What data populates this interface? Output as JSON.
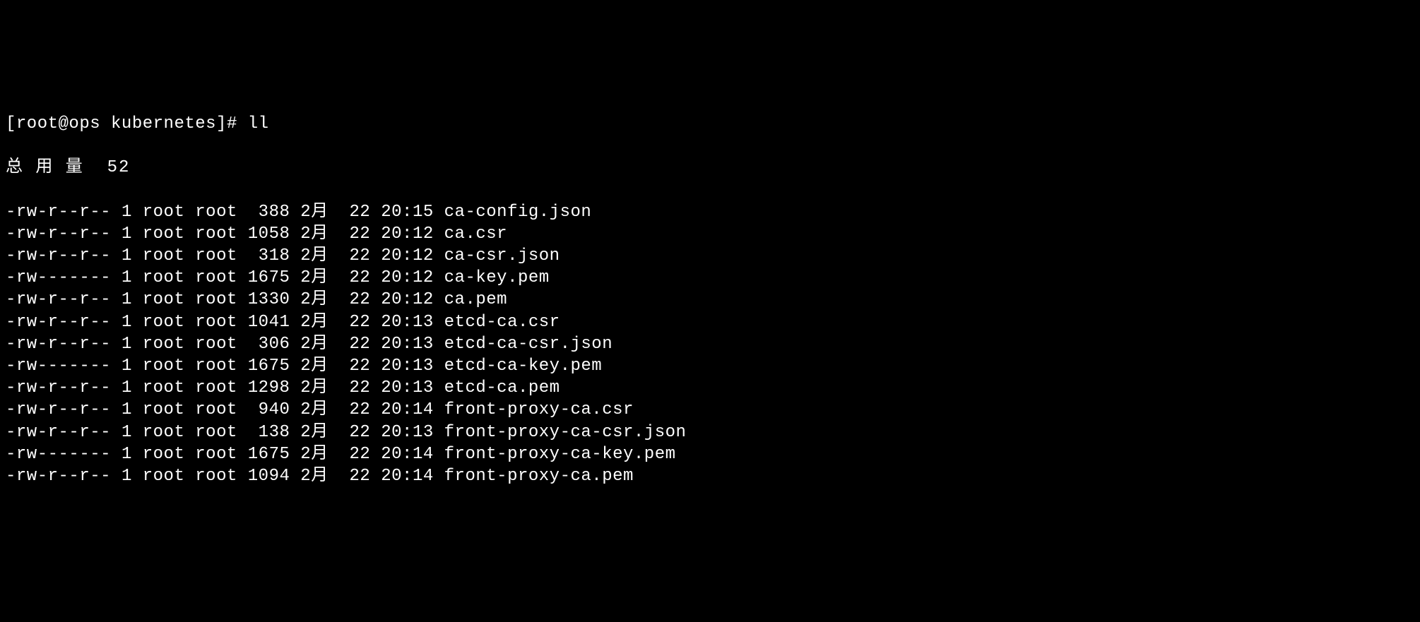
{
  "prompt": {
    "text": "[root@ops kubernetes]# ll"
  },
  "total": {
    "label": "总 用 量",
    "value": "52"
  },
  "files": [
    {
      "perms": "-rw-r--r--",
      "links": "1",
      "owner": "root",
      "group": "root",
      "size": " 388",
      "month": "2月",
      "day": "22",
      "time": "20:15",
      "name": "ca-config.json"
    },
    {
      "perms": "-rw-r--r--",
      "links": "1",
      "owner": "root",
      "group": "root",
      "size": "1058",
      "month": "2月",
      "day": "22",
      "time": "20:12",
      "name": "ca.csr"
    },
    {
      "perms": "-rw-r--r--",
      "links": "1",
      "owner": "root",
      "group": "root",
      "size": " 318",
      "month": "2月",
      "day": "22",
      "time": "20:12",
      "name": "ca-csr.json"
    },
    {
      "perms": "-rw-------",
      "links": "1",
      "owner": "root",
      "group": "root",
      "size": "1675",
      "month": "2月",
      "day": "22",
      "time": "20:12",
      "name": "ca-key.pem"
    },
    {
      "perms": "-rw-r--r--",
      "links": "1",
      "owner": "root",
      "group": "root",
      "size": "1330",
      "month": "2月",
      "day": "22",
      "time": "20:12",
      "name": "ca.pem"
    },
    {
      "perms": "-rw-r--r--",
      "links": "1",
      "owner": "root",
      "group": "root",
      "size": "1041",
      "month": "2月",
      "day": "22",
      "time": "20:13",
      "name": "etcd-ca.csr"
    },
    {
      "perms": "-rw-r--r--",
      "links": "1",
      "owner": "root",
      "group": "root",
      "size": " 306",
      "month": "2月",
      "day": "22",
      "time": "20:13",
      "name": "etcd-ca-csr.json"
    },
    {
      "perms": "-rw-------",
      "links": "1",
      "owner": "root",
      "group": "root",
      "size": "1675",
      "month": "2月",
      "day": "22",
      "time": "20:13",
      "name": "etcd-ca-key.pem"
    },
    {
      "perms": "-rw-r--r--",
      "links": "1",
      "owner": "root",
      "group": "root",
      "size": "1298",
      "month": "2月",
      "day": "22",
      "time": "20:13",
      "name": "etcd-ca.pem"
    },
    {
      "perms": "-rw-r--r--",
      "links": "1",
      "owner": "root",
      "group": "root",
      "size": " 940",
      "month": "2月",
      "day": "22",
      "time": "20:14",
      "name": "front-proxy-ca.csr"
    },
    {
      "perms": "-rw-r--r--",
      "links": "1",
      "owner": "root",
      "group": "root",
      "size": " 138",
      "month": "2月",
      "day": "22",
      "time": "20:13",
      "name": "front-proxy-ca-csr.json"
    },
    {
      "perms": "-rw-------",
      "links": "1",
      "owner": "root",
      "group": "root",
      "size": "1675",
      "month": "2月",
      "day": "22",
      "time": "20:14",
      "name": "front-proxy-ca-key.pem"
    },
    {
      "perms": "-rw-r--r--",
      "links": "1",
      "owner": "root",
      "group": "root",
      "size": "1094",
      "month": "2月",
      "day": "22",
      "time": "20:14",
      "name": "front-proxy-ca.pem"
    }
  ]
}
